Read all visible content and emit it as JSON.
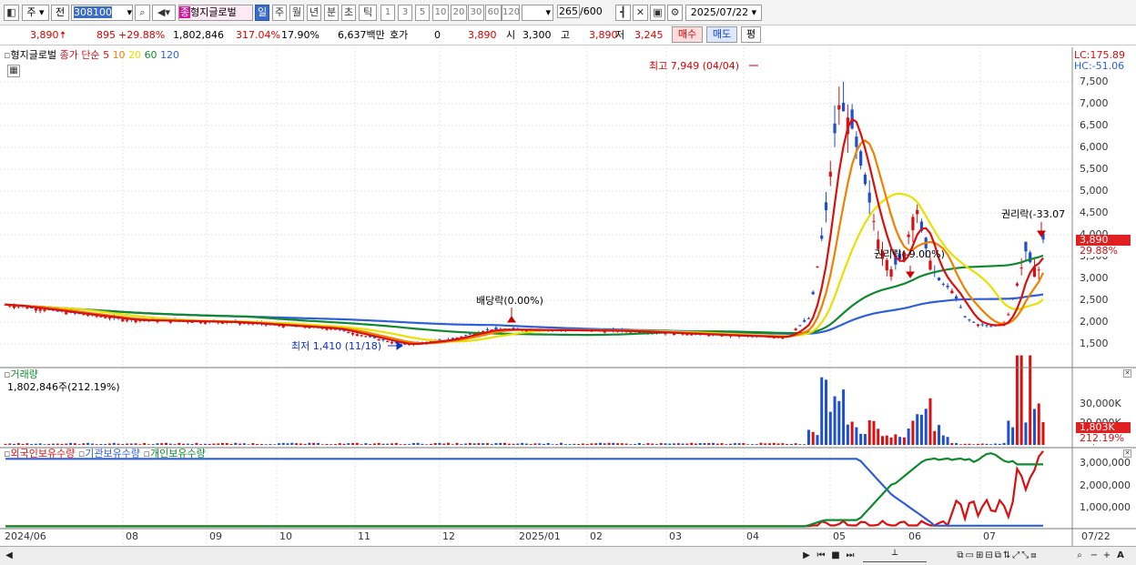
{
  "toolbar": {
    "market": "주",
    "prev": "전",
    "code": "308100",
    "name": "형지글로벌",
    "name_badge": "종",
    "periods": [
      "일",
      "주",
      "월",
      "년",
      "분",
      "초",
      "틱"
    ],
    "selected_period": "일",
    "minutes": [
      "1",
      "3",
      "5",
      "10",
      "20",
      "30",
      "60",
      "120"
    ],
    "count": "265",
    "count_total": "/600",
    "date": "2025/07/22"
  },
  "infobar": {
    "price": "3,890",
    "change": "895",
    "change_pct": "+29.88%",
    "volume": "1,802,846",
    "vol_ratio": "317.04%",
    "turnover": "17.90%",
    "amount": "6,637백만",
    "hoga_label": "호가",
    "hoga_value": "0",
    "hoga_price": "3,890",
    "open_label": "시",
    "open": "3,300",
    "high_label": "고",
    "high": "3,890",
    "low_label": "저",
    "low": "3,245",
    "buy": "매수",
    "sell": "매도",
    "avg": "평"
  },
  "price_panel": {
    "title": "형지글로벌",
    "legend_prefix": "종가 단순",
    "ma": [
      {
        "label": "5",
        "color": "#d81010"
      },
      {
        "label": "10",
        "color": "#f08000"
      },
      {
        "label": "20",
        "color": "#e8e000"
      },
      {
        "label": "60",
        "color": "#108830"
      },
      {
        "label": "120",
        "color": "#2f5fd8"
      }
    ],
    "lc": "LC:175.89",
    "hc": "HC:-51.06",
    "last_tag": "3,890",
    "pct_tag": "29.88%",
    "annotations": {
      "high": "최고 7,949 (04/04)",
      "low": "최저 1,410 (11/18)",
      "div1": "배당락(0.00%)",
      "div2": "권리락(-9.00%)",
      "div3": "권리락(-33.07"
    },
    "axis": [
      "7,500",
      "7,000",
      "6,500",
      "6,000",
      "5,500",
      "5,000",
      "4,500",
      "4,000",
      "3,500",
      "3,000",
      "2,500",
      "2,000",
      "1,500"
    ]
  },
  "volume_panel": {
    "title": "거래량",
    "value": "1,802,846주(212.19%)",
    "tag": "1,803K",
    "tag_pct": "212.19%",
    "axis": [
      "30,000K",
      "20,000K",
      "10,000K"
    ]
  },
  "holdings_panel": {
    "legend": [
      "외국인보유수량",
      "기관보유수량",
      "개인보유수량"
    ],
    "colors": [
      "#d81010",
      "#2f5fd8",
      "#108830"
    ],
    "axis": [
      "3,000,000",
      "2,000,000",
      "1,000,000"
    ]
  },
  "x_axis": [
    "2024/06",
    "08",
    "09",
    "10",
    "11",
    "12",
    "2025/01",
    "02",
    "03",
    "04",
    "05",
    "06",
    "07",
    "07/22"
  ]
}
